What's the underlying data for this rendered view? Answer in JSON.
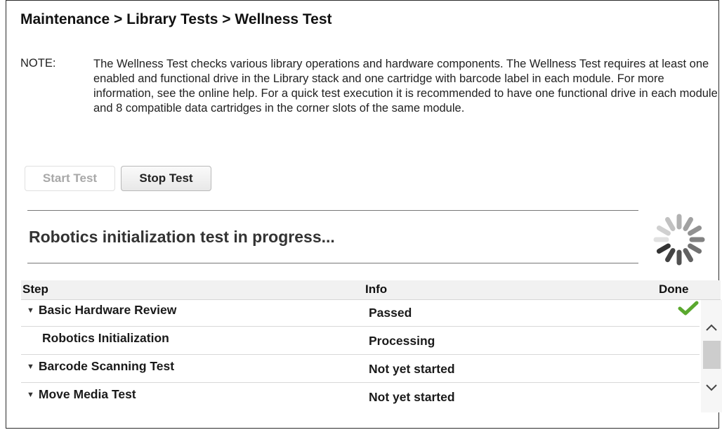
{
  "header": {
    "title": "Maintenance > Library Tests > Wellness Test"
  },
  "note": {
    "label": "NOTE:",
    "text": "The Wellness Test checks various library operations and hardware components. The Wellness Test requires at least one enabled and functional drive in the Library stack and one cartridge with barcode label in each module. For more information, see the online help. For a quick test execution it is recommended to have one functional drive in each module and 8 compatible data cartridges in the corner slots of the same module."
  },
  "buttons": {
    "start": "Start Test",
    "stop": "Stop Test"
  },
  "status": {
    "text": "Robotics initialization test in progress...",
    "icon": "spinner-icon"
  },
  "table": {
    "columns": {
      "step": "Step",
      "info": "Info",
      "done": "Done"
    },
    "rows": [
      {
        "step": "Basic Hardware Review",
        "info": "Passed",
        "expandable": true,
        "done_icon": "check-icon"
      },
      {
        "step": "Robotics Initialization",
        "info": "Processing",
        "expandable": false,
        "done_icon": ""
      },
      {
        "step": "Barcode Scanning Test",
        "info": "Not yet started",
        "expandable": true,
        "done_icon": ""
      },
      {
        "step": "Move Media Test",
        "info": "Not yet started",
        "expandable": true,
        "done_icon": ""
      }
    ]
  },
  "colors": {
    "check": "#5aa82e",
    "spinner": "#333333",
    "disabled_text": "#a8a8a8"
  }
}
